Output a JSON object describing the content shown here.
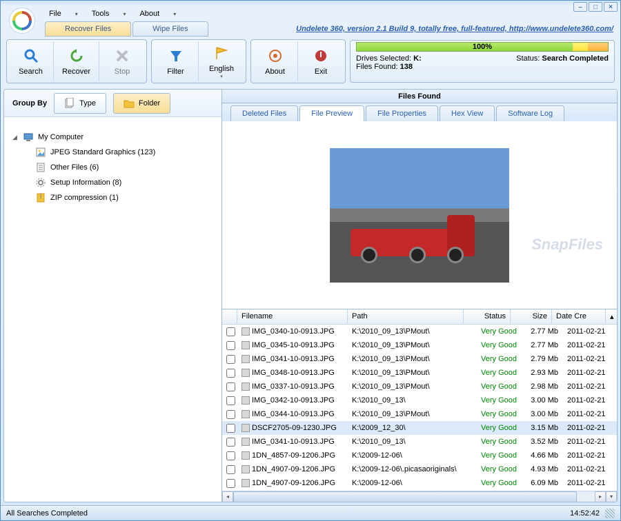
{
  "menu": {
    "file": "File",
    "tools": "Tools",
    "about": "About"
  },
  "top_tabs": {
    "recover": "Recover Files",
    "wipe": "Wipe Files"
  },
  "about_link": "Undelete 360, version 2.1 Build 9, totally free, full-featured, http://www.undelete360.com/",
  "toolbar": {
    "search": "Search",
    "recover": "Recover",
    "stop": "Stop",
    "filter": "Filter",
    "english": "English",
    "about": "About",
    "exit": "Exit"
  },
  "status_panel": {
    "progress": "100%",
    "drives_label": "Drives Selected: ",
    "drives_value": "K:",
    "files_label": "Files Found: ",
    "files_value": "138",
    "status_label": "Status: ",
    "status_value": "Search Completed"
  },
  "group_by": {
    "label": "Group By",
    "type": "Type",
    "folder": "Folder"
  },
  "tree": {
    "root": "My Computer",
    "items": [
      {
        "label": "JPEG Standard Graphics (123)",
        "icon": "img"
      },
      {
        "label": "Other Files (6)",
        "icon": "doc"
      },
      {
        "label": "Setup Information (8)",
        "icon": "gear"
      },
      {
        "label": "ZIP compression (1)",
        "icon": "zip"
      }
    ]
  },
  "files_found_header": "Files Found",
  "inner_tabs": {
    "deleted": "Deleted Files",
    "preview": "File Preview",
    "properties": "File Properties",
    "hex": "Hex View",
    "log": "Software Log"
  },
  "watermark": "SnapFiles",
  "table": {
    "headers": {
      "filename": "Filename",
      "path": "Path",
      "status": "Status",
      "size": "Size",
      "date": "Date Cre"
    },
    "rows": [
      {
        "filename": "IMG_0340-10-0913.JPG",
        "path": "K:\\2010_09_13\\PMout\\",
        "status": "Very Good",
        "size": "2.77 Mb",
        "date": "2011-02-21"
      },
      {
        "filename": "IMG_0345-10-0913.JPG",
        "path": "K:\\2010_09_13\\PMout\\",
        "status": "Very Good",
        "size": "2.77 Mb",
        "date": "2011-02-21"
      },
      {
        "filename": "IMG_0341-10-0913.JPG",
        "path": "K:\\2010_09_13\\PMout\\",
        "status": "Very Good",
        "size": "2.79 Mb",
        "date": "2011-02-21"
      },
      {
        "filename": "IMG_0348-10-0913.JPG",
        "path": "K:\\2010_09_13\\PMout\\",
        "status": "Very Good",
        "size": "2.93 Mb",
        "date": "2011-02-21"
      },
      {
        "filename": "IMG_0337-10-0913.JPG",
        "path": "K:\\2010_09_13\\PMout\\",
        "status": "Very Good",
        "size": "2.98 Mb",
        "date": "2011-02-21"
      },
      {
        "filename": "IMG_0342-10-0913.JPG",
        "path": "K:\\2010_09_13\\",
        "status": "Very Good",
        "size": "3.00 Mb",
        "date": "2011-02-21"
      },
      {
        "filename": "IMG_0344-10-0913.JPG",
        "path": "K:\\2010_09_13\\PMout\\",
        "status": "Very Good",
        "size": "3.00 Mb",
        "date": "2011-02-21"
      },
      {
        "filename": "DSCF2705-09-1230.JPG",
        "path": "K:\\2009_12_30\\",
        "status": "Very Good",
        "size": "3.15 Mb",
        "date": "2011-02-21",
        "selected": true
      },
      {
        "filename": "IMG_0341-10-0913.JPG",
        "path": "K:\\2010_09_13\\",
        "status": "Very Good",
        "size": "3.52 Mb",
        "date": "2011-02-21"
      },
      {
        "filename": "1DN_4857-09-1206.JPG",
        "path": "K:\\2009-12-06\\",
        "status": "Very Good",
        "size": "4.66 Mb",
        "date": "2011-02-21"
      },
      {
        "filename": "1DN_4907-09-1206.JPG",
        "path": "K:\\2009-12-06\\.picasaoriginals\\",
        "status": "Very Good",
        "size": "4.93 Mb",
        "date": "2011-02-21"
      },
      {
        "filename": "1DN_4907-09-1206.JPG",
        "path": "K:\\2009-12-06\\",
        "status": "Very Good",
        "size": "6.09 Mb",
        "date": "2011-02-21"
      }
    ]
  },
  "statusbar": {
    "message": "All Searches Completed",
    "time": "14:52:42"
  }
}
